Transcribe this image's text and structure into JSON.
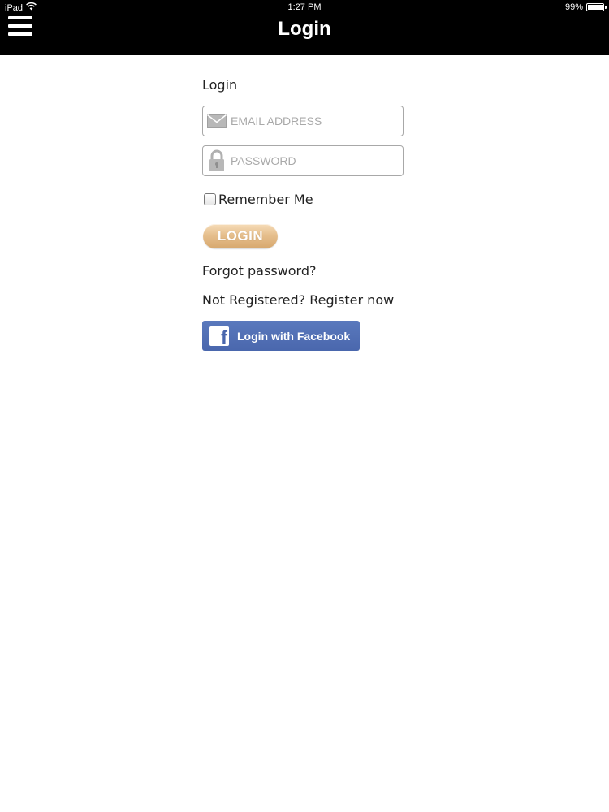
{
  "status_bar": {
    "device": "iPad",
    "time": "1:27 PM",
    "battery_percent": "99%",
    "battery_level": 0.99,
    "wifi_icon": "wifi-icon",
    "battery_icon": "battery-icon"
  },
  "nav": {
    "title": "Login",
    "menu_icon": "hamburger-menu-icon"
  },
  "form": {
    "heading": "Login",
    "email": {
      "placeholder": "EMAIL ADDRESS",
      "value": "",
      "icon": "envelope-icon"
    },
    "password": {
      "placeholder": "PASSWORD",
      "value": "",
      "icon": "lock-icon"
    },
    "remember_me": {
      "label": "Remember Me",
      "checked": false
    },
    "login_button": "LOGIN",
    "forgot_password": "Forgot password?",
    "register": "Not Registered? Register now",
    "facebook_button": "Login with Facebook",
    "facebook_icon": "facebook-icon"
  },
  "colors": {
    "topbar": "#000000",
    "login_button": "#e6bf8d",
    "facebook_button": "#4a67ad"
  }
}
